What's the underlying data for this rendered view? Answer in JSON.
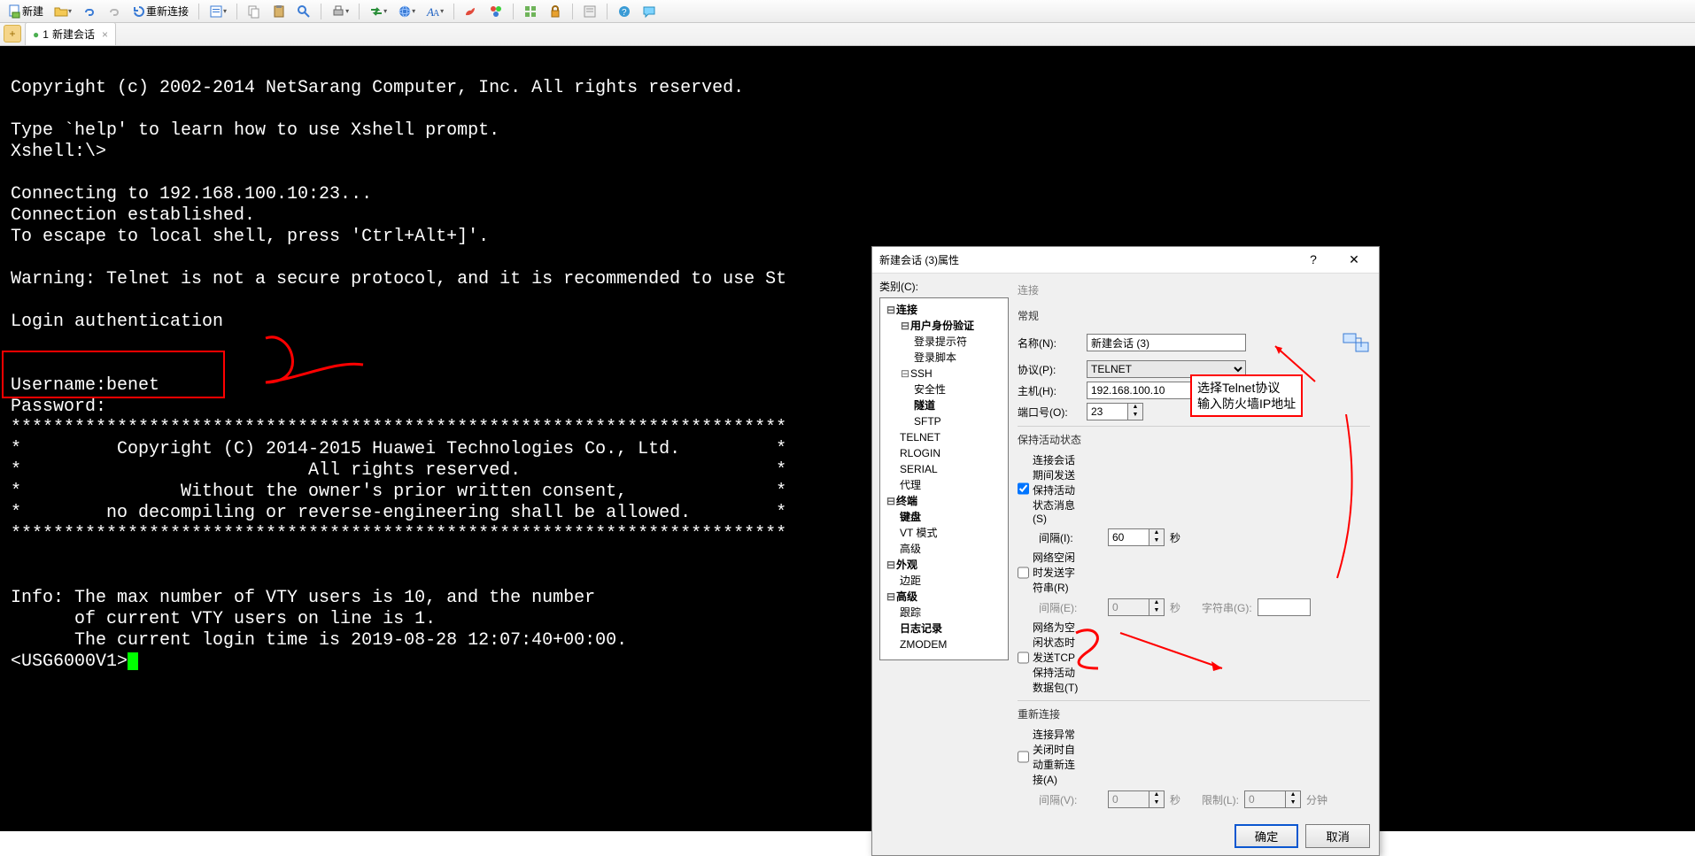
{
  "toolbar": {
    "new_label": "新建",
    "reconnect_label": "重新连接"
  },
  "tabs": {
    "tab1": {
      "index": "1",
      "label": "新建会话"
    }
  },
  "terminal": {
    "lines": [
      "Copyright (c) 2002-2014 NetSarang Computer, Inc. All rights reserved.",
      "",
      "Type `help' to learn how to use Xshell prompt.",
      "Xshell:\\>",
      "",
      "Connecting to 192.168.100.10:23...",
      "Connection established.",
      "To escape to local shell, press 'Ctrl+Alt+]'.",
      "",
      "Warning: Telnet is not a secure protocol, and it is recommended to use St",
      "",
      "Login authentication",
      "",
      "",
      "Username:benet",
      "Password:",
      "*************************************************************************",
      "*         Copyright (C) 2014-2015 Huawei Technologies Co., Ltd.         *",
      "*                           All rights reserved.                        *",
      "*               Without the owner's prior written consent,              *",
      "*        no decompiling or reverse-engineering shall be allowed.        *",
      "*************************************************************************",
      "",
      "",
      "Info: The max number of VTY users is 10, and the number",
      "      of current VTY users on line is 1.",
      "      The current login time is 2019-08-28 12:07:40+00:00."
    ],
    "prompt": "<USG6000V1>"
  },
  "dialog": {
    "title": "新建会话 (3)属性",
    "help": "?",
    "close": "✕",
    "category_label": "类别(C):",
    "tree": {
      "conn": "连接",
      "auth": "用户身份验证",
      "prompt": "登录提示符",
      "script": "登录脚本",
      "ssh": "SSH",
      "security": "安全性",
      "tunnel": "隧道",
      "sftp": "SFTP",
      "telnet": "TELNET",
      "rlogin": "RLOGIN",
      "serial": "SERIAL",
      "proxy": "代理",
      "terminal": "终端",
      "keyboard": "键盘",
      "vtmode": "VT 模式",
      "adv": "高级",
      "appearance": "外观",
      "margin": "边距",
      "adv2": "高级",
      "trace": "跟踪",
      "log": "日志记录",
      "zmodem": "ZMODEM"
    },
    "right": {
      "header": "连接",
      "grp_general": "常规",
      "name_label": "名称(N):",
      "name_value": "新建会话 (3)",
      "protocol_label": "协议(P):",
      "protocol_value": "TELNET",
      "host_label": "主机(H):",
      "host_value": "192.168.100.10",
      "port_label": "端口号(O):",
      "port_value": "23",
      "grp_keepalive": "保持活动状态",
      "ka_chk": "连接会话期间发送保持活动状态消息(S)",
      "interval_i_label": "间隔(I):",
      "interval_i_value": "60",
      "seconds": "秒",
      "idle_chk": "网络空闲时发送字符串(R)",
      "interval_e_label": "间隔(E):",
      "interval_e_value": "0",
      "string_label": "字符串(G):",
      "tcp_chk": "网络为空闲状态时发送TCP保持活动数据包(T)",
      "grp_reconnect": "重新连接",
      "reconn_chk": "连接异常关闭时自动重新连接(A)",
      "interval_v_label": "间隔(V):",
      "interval_v_value": "0",
      "limit_label": "限制(L):",
      "limit_value": "0",
      "minutes": "分钟",
      "ok": "确定",
      "cancel": "取消"
    }
  },
  "callout": {
    "line1": "选择Telnet协议",
    "line2": "输入防火墙IP地址"
  }
}
